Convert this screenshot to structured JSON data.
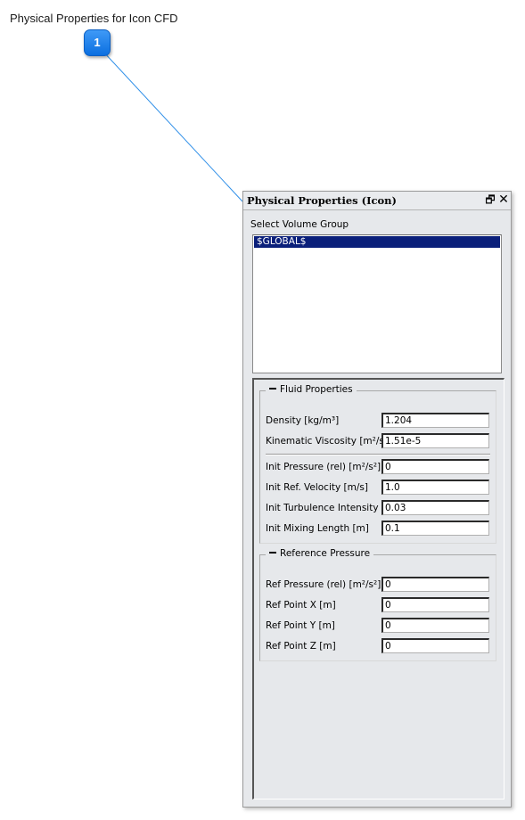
{
  "doc_title": "Physical Properties for Icon CFD",
  "callout": {
    "number": "1"
  },
  "panel": {
    "title": "Physical Properties (Icon)",
    "restore_icon": "restore-icon",
    "close_icon": "close-icon",
    "restore_glyph": "🗗",
    "close_glyph": "✕",
    "select_label": "Select Volume Group",
    "volume_groups": [
      "$GLOBAL$"
    ]
  },
  "fluid": {
    "title": "Fluid Properties",
    "density_label": "Density [kg/m³]",
    "density_value": "1.204",
    "kinvisc_label": "Kinematic Viscosity [m²/s]",
    "kinvisc_value": "1.51e-5",
    "initpress_label": "Init Pressure (rel) [m²/s²]",
    "initpress_value": "0",
    "initvel_label": "Init Ref. Velocity [m/s]",
    "initvel_value": "1.0",
    "initturb_label": "Init Turbulence Intensity",
    "initturb_value": "0.03",
    "initmix_label": "Init Mixing Length [m]",
    "initmix_value": "0.1"
  },
  "reference": {
    "title": "Reference Pressure",
    "refpress_label": "Ref Pressure (rel) [m²/s²]",
    "refpress_value": "0",
    "refx_label": "Ref Point X [m]",
    "refx_value": "0",
    "refy_label": "Ref Point Y [m]",
    "refy_value": "0",
    "refz_label": "Ref Point Z [m]",
    "refz_value": "0"
  },
  "colors": {
    "callout_blue": "#0b6fe0",
    "selection": "#0a1f7a",
    "panel_bg": "#e6e8eb"
  }
}
